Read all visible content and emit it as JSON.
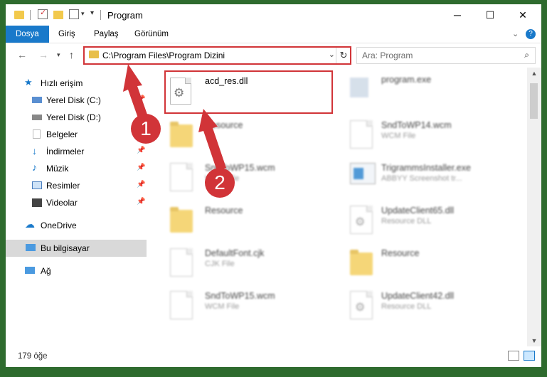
{
  "window": {
    "title": "Program"
  },
  "window_controls": {
    "minimize": "─",
    "maximize": "☐",
    "close": "✕"
  },
  "ribbon": {
    "tabs": [
      "Dosya",
      "Giriş",
      "Paylaş",
      "Görünüm"
    ]
  },
  "address": {
    "path": "C:\\Program Files\\Program Dizini"
  },
  "search": {
    "placeholder": "Ara: Program"
  },
  "sidebar": {
    "quick_access": "Hızlı erişim",
    "items": [
      {
        "label": "Yerel Disk (C:)"
      },
      {
        "label": "Yerel Disk (D:)"
      },
      {
        "label": "Belgeler"
      },
      {
        "label": "İndirmeler"
      },
      {
        "label": "Müzik"
      },
      {
        "label": "Resimler"
      },
      {
        "label": "Videolar"
      }
    ],
    "onedrive": "OneDrive",
    "this_pc": "Bu bilgisayar",
    "network": "Ağ"
  },
  "files": [
    {
      "name": "acd_res.dll",
      "sub": ""
    },
    {
      "name": "program.exe",
      "sub": ""
    },
    {
      "name": "Resource",
      "sub": ""
    },
    {
      "name": "SndToWP14.wcm",
      "sub": "WCM File"
    },
    {
      "name": "SndToWP15.wcm",
      "sub": "WCM File"
    },
    {
      "name": "TrigrammsInstaller.exe",
      "sub": "ABBYY Screenshot tr..."
    },
    {
      "name": "Resource",
      "sub": ""
    },
    {
      "name": "UpdateClient65.dll",
      "sub": "Resource DLL"
    },
    {
      "name": "DefaultFont.cjk",
      "sub": "CJK File"
    },
    {
      "name": "Resource",
      "sub": ""
    },
    {
      "name": "SndToWP15.wcm",
      "sub": "WCM File"
    },
    {
      "name": "UpdateClient42.dll",
      "sub": "Resource DLL"
    }
  ],
  "annotations": {
    "badge1": "1",
    "badge2": "2"
  },
  "status": {
    "count": "179 öğe"
  },
  "colors": {
    "accent": "#1979ca",
    "highlight": "#d13438",
    "folder": "#f2c94c"
  }
}
